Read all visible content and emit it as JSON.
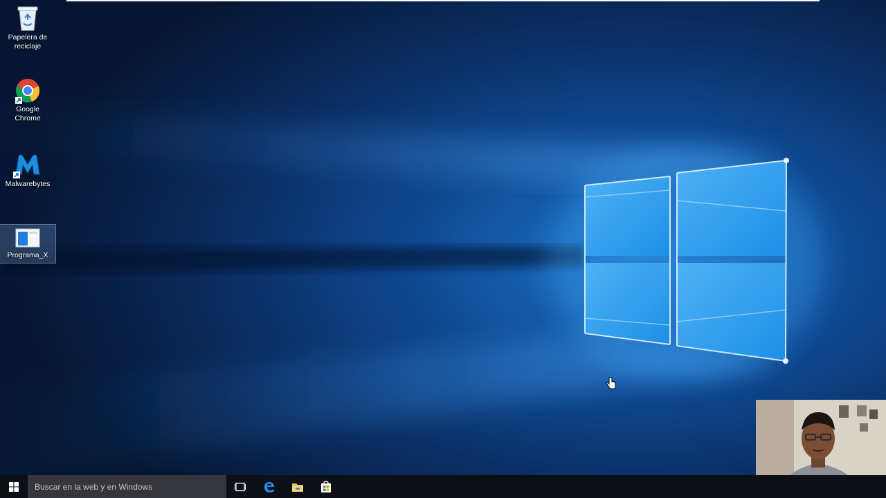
{
  "desktop": {
    "icons": [
      {
        "label": "Papelera de reciclaje",
        "icon": "recycle-bin-icon"
      },
      {
        "label": "Google Chrome",
        "icon": "chrome-icon",
        "shortcut": true
      },
      {
        "label": "Malwarebytes",
        "icon": "malwarebytes-icon",
        "shortcut": true
      },
      {
        "label": "Programa_X",
        "icon": "program-window-icon",
        "selected": true
      }
    ]
  },
  "taskbar": {
    "search_placeholder": "Buscar en la web y en Windows",
    "items": [
      "windows-start-icon",
      "task-view-icon",
      "edge-icon",
      "file-explorer-icon",
      "store-icon"
    ]
  },
  "colors": {
    "wallpaper_dark": "#07183a",
    "wallpaper_glow": "#1f7fd6",
    "taskbar": "#0c0f15",
    "search_box": "#34363b"
  }
}
